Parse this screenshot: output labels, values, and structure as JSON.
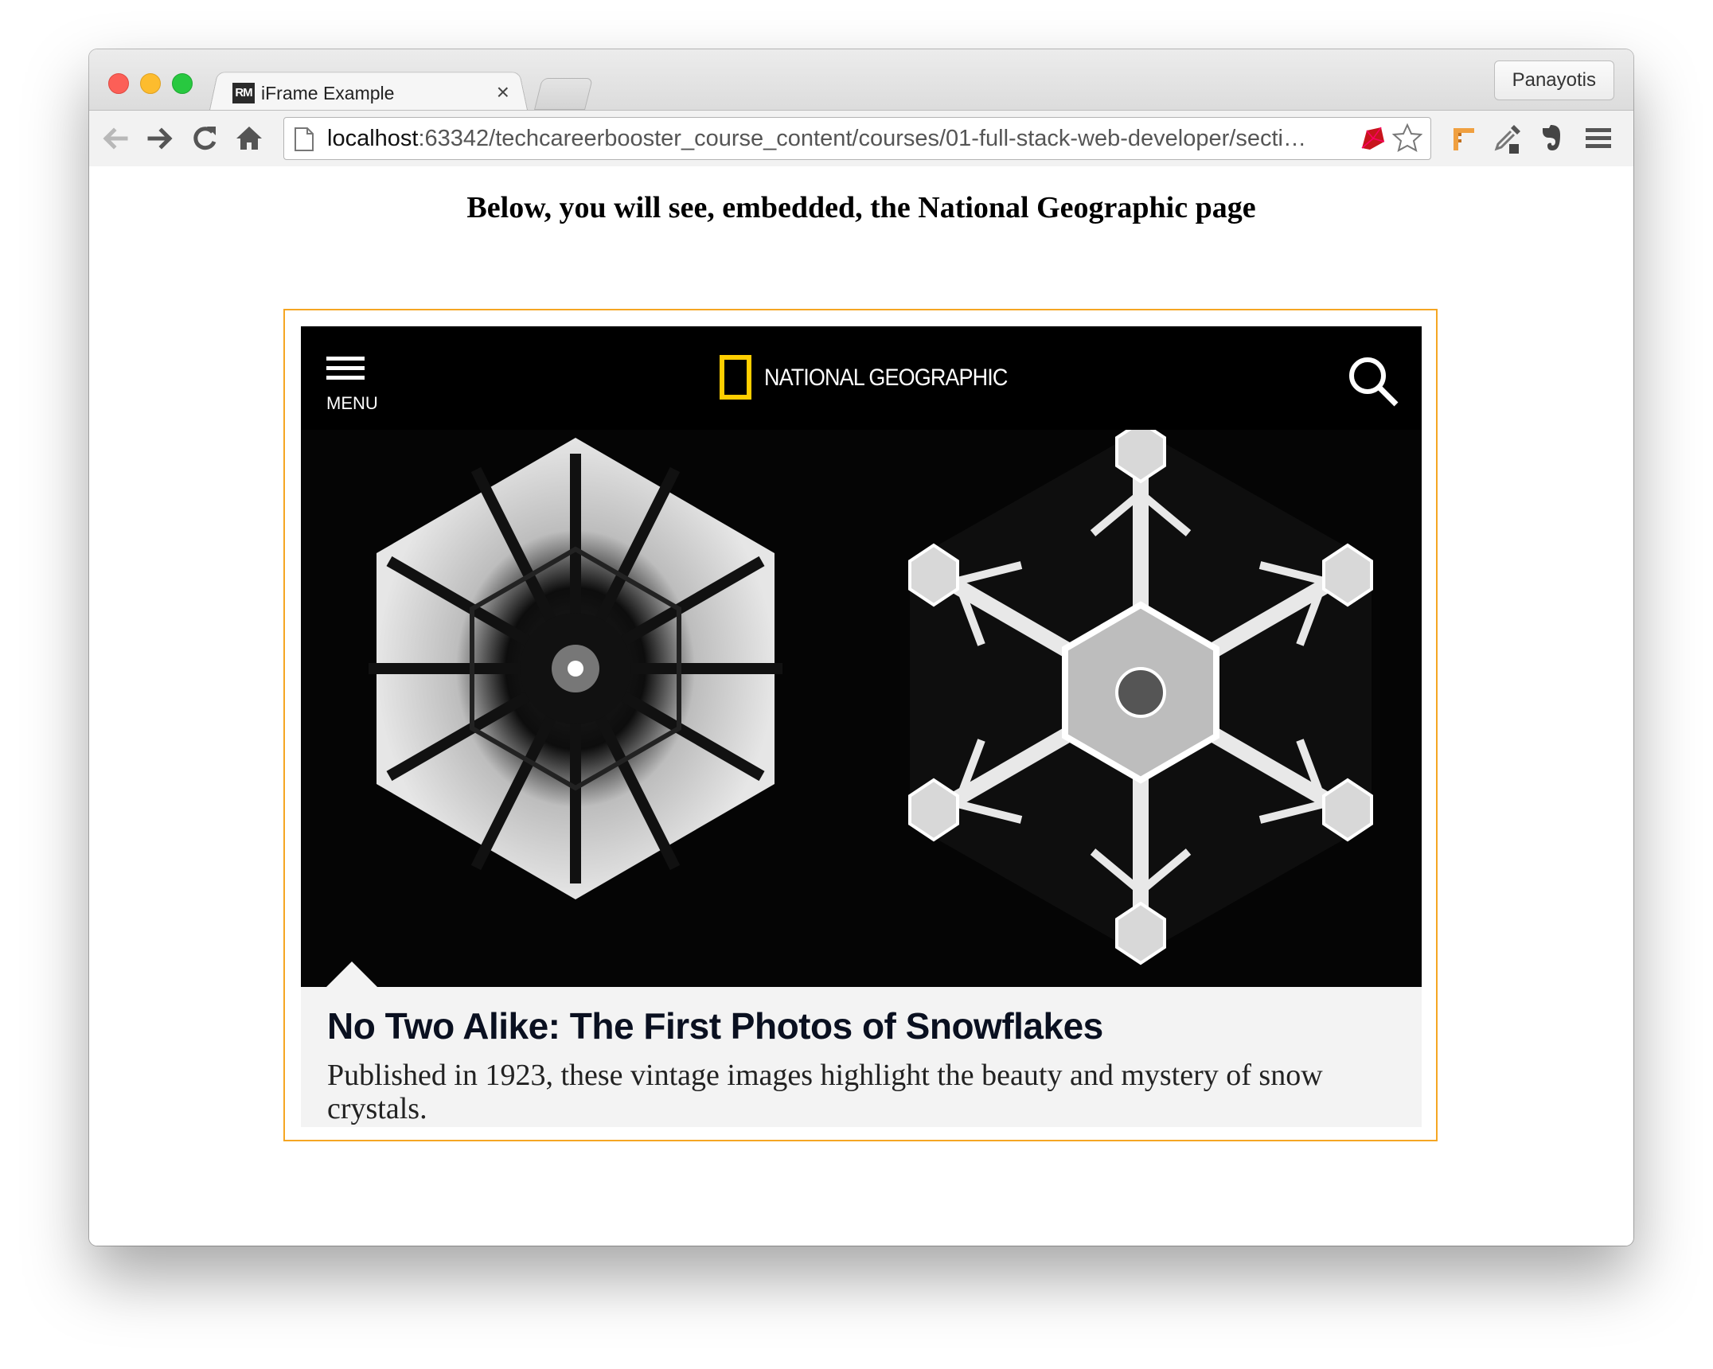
{
  "browser": {
    "tab": {
      "favicon_text": "RM",
      "title": "iFrame Example",
      "close_glyph": "×"
    },
    "profile_name": "Panayotis",
    "url": {
      "host": "localhost",
      "path": ":63342/techcareerbooster_course_content/courses/01-full-stack-web-developer/secti…"
    },
    "nav_icons": [
      "back-arrow-icon",
      "forward-arrow-icon",
      "reload-icon",
      "home-icon"
    ],
    "extension_icons": [
      "ruby-icon",
      "star-icon",
      "pencil-ruler-icon",
      "eyedropper-icon",
      "evernote-icon",
      "hamburger-menu-icon"
    ]
  },
  "page": {
    "heading": "Below, you will see, embedded, the National Geographic page"
  },
  "natgeo": {
    "menu_label": "MENU",
    "brand": "NATIONAL GEOGRAPHIC",
    "brand_color": "#ffce00",
    "article_title": "No Two Alike: The First Photos of Snowflakes",
    "article_subtitle": "Published in 1923, these vintage images highlight the beauty and mystery of snow crystals."
  },
  "colors": {
    "iframe_border": "#f5a623",
    "header_bg": "#000000",
    "caption_bg": "#f3f3f3"
  }
}
